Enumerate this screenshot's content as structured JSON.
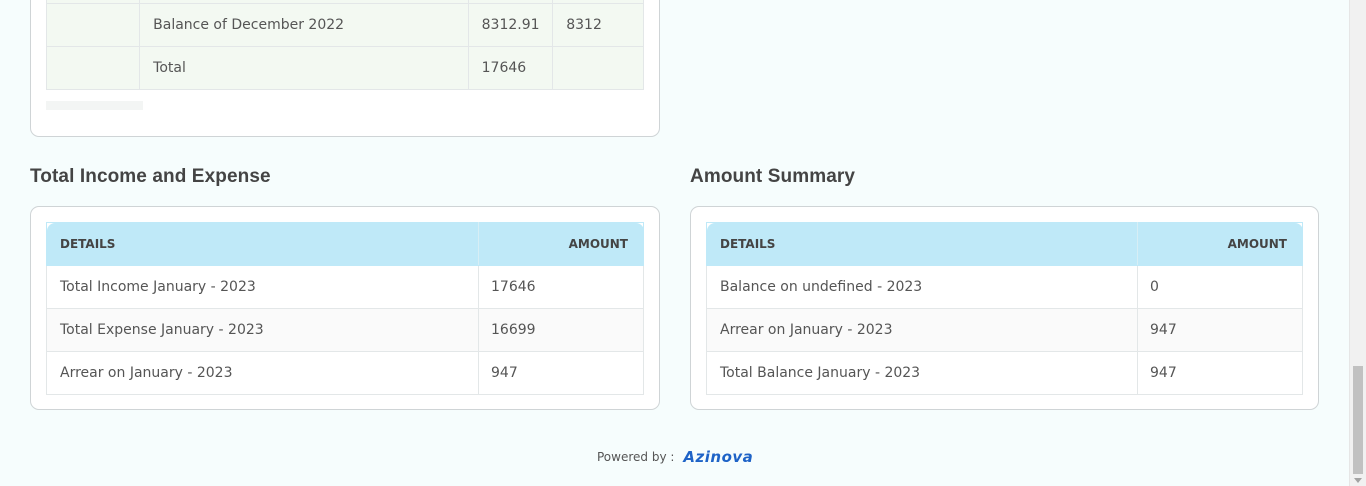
{
  "top_table": {
    "rows": [
      {
        "desc": "",
        "val1": "",
        "val2": ""
      },
      {
        "desc": "Balance of December 2022",
        "val1": "8312.91",
        "val2": "8312"
      },
      {
        "desc": "Total",
        "val1": "17646",
        "val2": ""
      }
    ]
  },
  "income": {
    "title": "Total Income and Expense",
    "headers": {
      "details": "DETAILS",
      "amount": "AMOUNT"
    },
    "rows": [
      {
        "label": "Total Income January - 2023",
        "amount": "17646"
      },
      {
        "label": "Total Expense January - 2023",
        "amount": "16699"
      },
      {
        "label": "Arrear on January - 2023",
        "amount": "947"
      }
    ]
  },
  "summary": {
    "title": "Amount Summary",
    "headers": {
      "details": "DETAILS",
      "amount": "AMOUNT"
    },
    "rows": [
      {
        "label": "Balance on undefined - 2023",
        "amount": "0"
      },
      {
        "label": "Arrear on January - 2023",
        "amount": "947"
      },
      {
        "label": "Total Balance January - 2023",
        "amount": "947"
      }
    ]
  },
  "footer": {
    "powered_by": "Powered by :",
    "brand": "Azinova",
    "brand_color": "#1e63c7"
  }
}
